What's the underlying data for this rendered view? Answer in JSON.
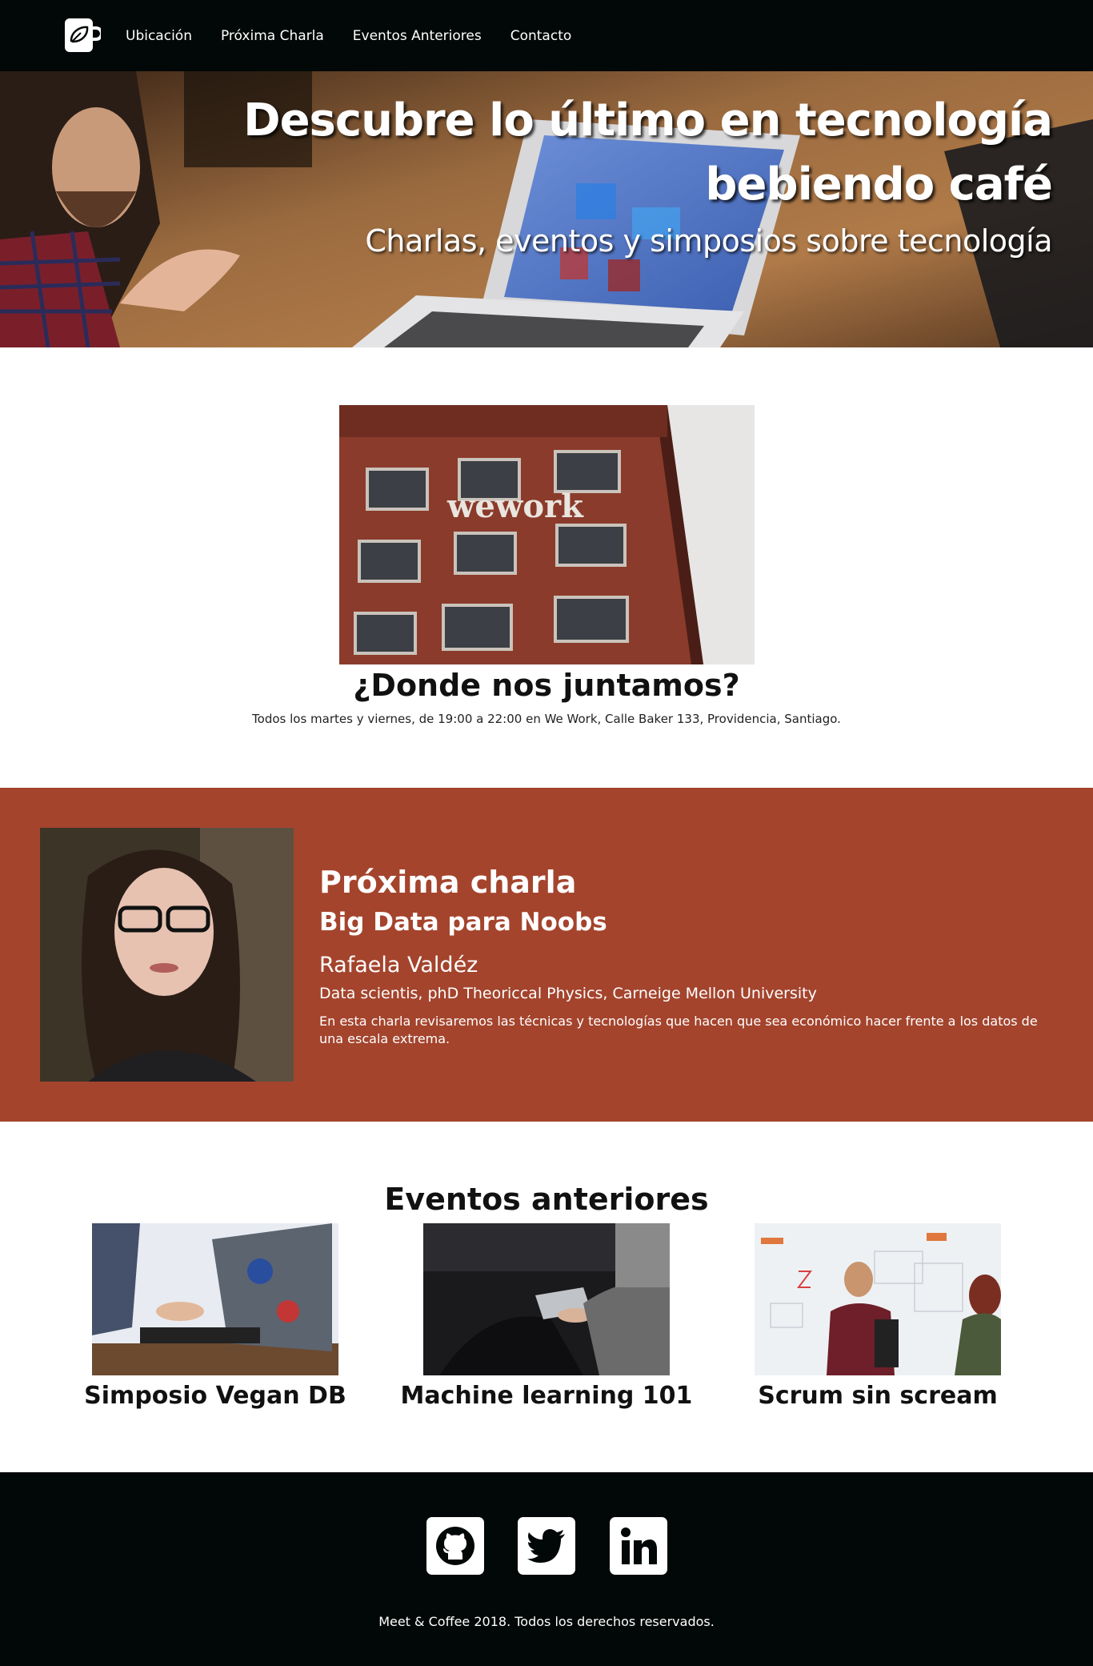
{
  "nav": {
    "logo_icon": "coffee-cup-leaf-icon",
    "links": [
      "Ubicación",
      "Próxima Charla",
      "Eventos Anteriores",
      "Contacto"
    ]
  },
  "hero": {
    "title_line1": "Descubre lo último en tecnología",
    "title_line2": "bebiendo café",
    "subtitle": "Charlas, eventos y simposios sobre tecnología"
  },
  "location": {
    "image_label": "wework",
    "title": "¿Donde nos juntamos?",
    "text": "Todos los martes y viernes, de 19:00 a 22:00 en We Work, Calle Baker 133, Providencia, Santiago."
  },
  "next_talk": {
    "label": "Próxima charla",
    "title": "Big Data para Noobs",
    "speaker": "Rafaela Valdéz",
    "credentials": "Data scientis, phD Theoriccal Physics, Carneige Mellon University",
    "description": "En esta charla revisaremos las técnicas y tecnologías que hacen que sea económico hacer frente a los datos de una escala extrema."
  },
  "past_events": {
    "title": "Eventos anteriores",
    "items": [
      {
        "title": "Simposio Vegan DB"
      },
      {
        "title": "Machine learning 101"
      },
      {
        "title": "Scrum sin scream"
      }
    ]
  },
  "footer": {
    "social": [
      "github-icon",
      "twitter-icon",
      "linkedin-icon"
    ],
    "copyright": "Meet & Coffee 2018. Todos los derechos reservados."
  },
  "colors": {
    "nav_bg": "#020807",
    "accent": "#a4442d",
    "text": "#111111"
  }
}
